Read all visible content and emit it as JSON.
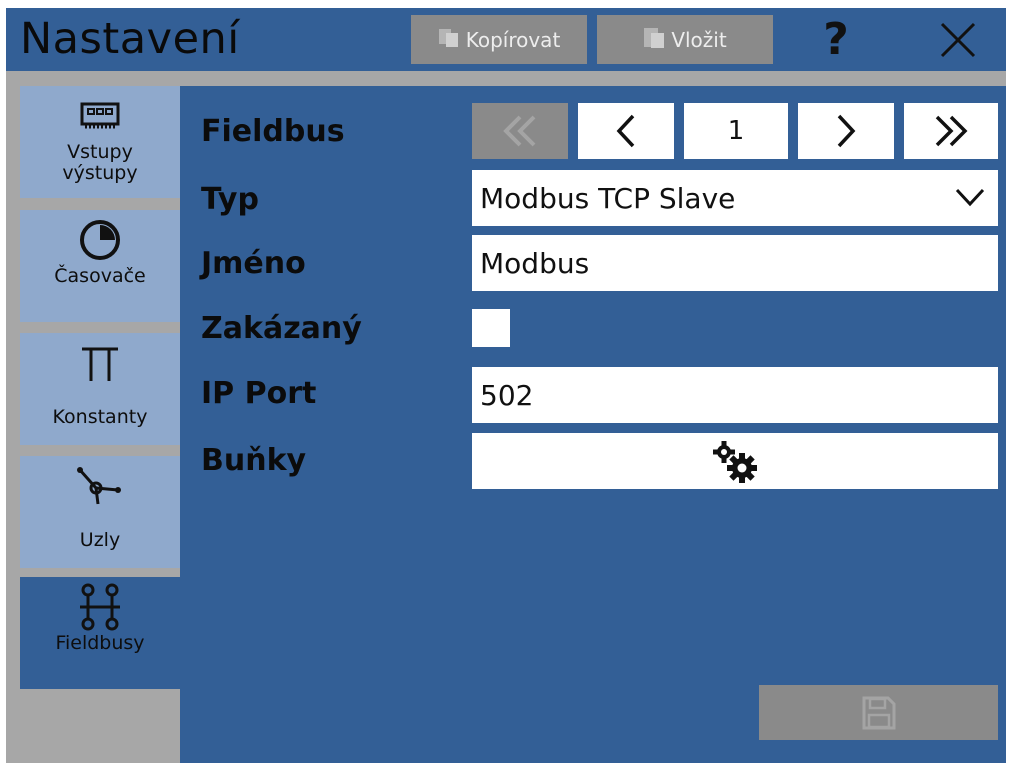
{
  "header": {
    "title": "Nastavení",
    "copy_label": "Kopírovat",
    "paste_label": "Vložit",
    "help_label": "?"
  },
  "sidebar": {
    "items": [
      {
        "label": "Vstupy\nvýstupy",
        "icon": "io-board-icon",
        "active": false
      },
      {
        "label": "Časovače",
        "icon": "timer-icon",
        "active": false
      },
      {
        "label": "Konstanty",
        "icon": "pi-icon",
        "active": false
      },
      {
        "label": "Uzly",
        "icon": "node-icon",
        "active": false
      },
      {
        "label": "Fieldbusy",
        "icon": "fieldbus-icon",
        "active": true
      }
    ]
  },
  "form": {
    "fieldbus_label": "Fieldbus",
    "pager": {
      "current": "1"
    },
    "type_label": "Typ",
    "type_value": "Modbus TCP Slave",
    "name_label": "Jméno",
    "name_value": "Modbus",
    "disabled_label": "Zakázaný",
    "disabled_checked": false,
    "port_label": "IP Port",
    "port_value": "502",
    "cells_label": "Buňky"
  },
  "colors": {
    "panel_blue": "#335f96",
    "nav_inactive": "#8fa9cc",
    "disabled_gray": "#8a8a8a",
    "frame_gray": "#a7a7a7"
  }
}
